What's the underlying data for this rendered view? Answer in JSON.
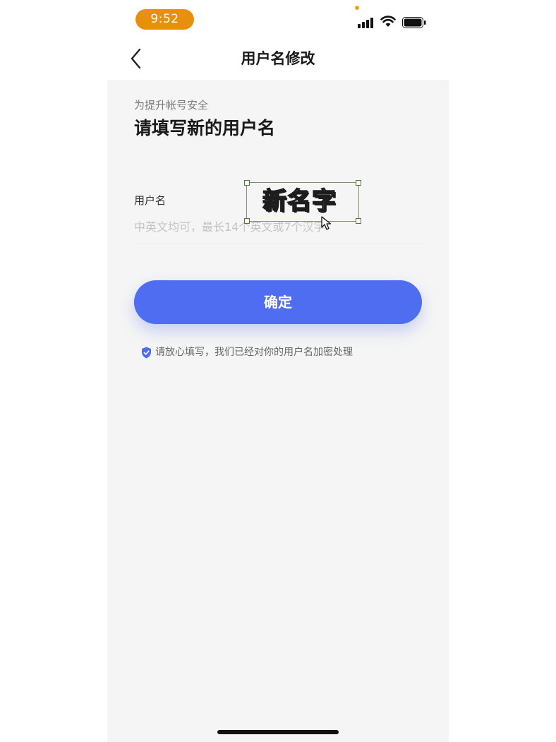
{
  "status_bar": {
    "time": "9:52",
    "accent_color": "#e8900b"
  },
  "nav": {
    "back_icon": "chevron-left-icon",
    "title": "用户名修改"
  },
  "intro": {
    "subtitle": "为提升帐号安全",
    "heading": "请填写新的用户名"
  },
  "form": {
    "label": "用户名",
    "value": "",
    "placeholder": "中英文均可，最长14个英文或7个汉字"
  },
  "overlay": {
    "sticker_text": "新名字"
  },
  "confirm_button": {
    "label": "确定",
    "color": "#4f6df0"
  },
  "notice": {
    "icon": "shield-check-icon",
    "text": "请放心填写，我们已经对你的用户名加密处理"
  }
}
